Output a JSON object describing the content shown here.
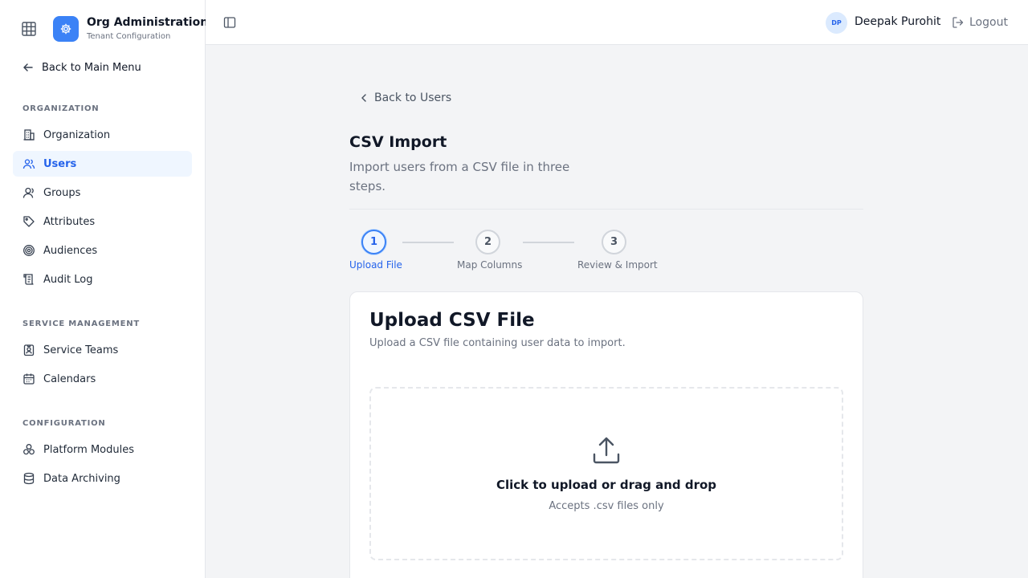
{
  "sidebar": {
    "brand": {
      "title": "Org Administration",
      "subtitle": "Tenant Configuration"
    },
    "back_label": "Back to Main Menu",
    "sections": [
      {
        "label": "ORGANIZATION",
        "items": [
          {
            "label": "Organization",
            "icon": "building-icon"
          },
          {
            "label": "Users",
            "icon": "users-icon",
            "active": true
          },
          {
            "label": "Groups",
            "icon": "group-icon"
          },
          {
            "label": "Attributes",
            "icon": "tag-icon"
          },
          {
            "label": "Audiences",
            "icon": "target-icon"
          },
          {
            "label": "Audit Log",
            "icon": "scroll-icon"
          }
        ]
      },
      {
        "label": "SERVICE MANAGEMENT",
        "items": [
          {
            "label": "Service Teams",
            "icon": "id-badge-icon"
          },
          {
            "label": "Calendars",
            "icon": "calendar-icon"
          }
        ]
      },
      {
        "label": "CONFIGURATION",
        "items": [
          {
            "label": "Platform Modules",
            "icon": "modules-icon"
          },
          {
            "label": "Data Archiving",
            "icon": "database-icon"
          }
        ]
      }
    ]
  },
  "topbar": {
    "user": {
      "initials": "DP",
      "name": "Deepak Purohit"
    },
    "logout_label": "Logout"
  },
  "main": {
    "back_label": "Back to Users",
    "title": "CSV Import",
    "description": "Import users from a CSV file in three steps.",
    "steps": [
      {
        "number": "1",
        "label": "Upload File",
        "active": true
      },
      {
        "number": "2",
        "label": "Map Columns",
        "active": false
      },
      {
        "number": "3",
        "label": "Review & Import",
        "active": false
      }
    ],
    "card": {
      "title": "Upload CSV File",
      "description": "Upload a CSV file containing user data to import.",
      "dropzone": {
        "title": "Click to upload or drag and drop",
        "hint": "Accepts .csv files only"
      }
    }
  },
  "colors": {
    "accent": "#3b82f6",
    "accent_text": "#2563eb",
    "active_bg": "#eff6ff"
  }
}
